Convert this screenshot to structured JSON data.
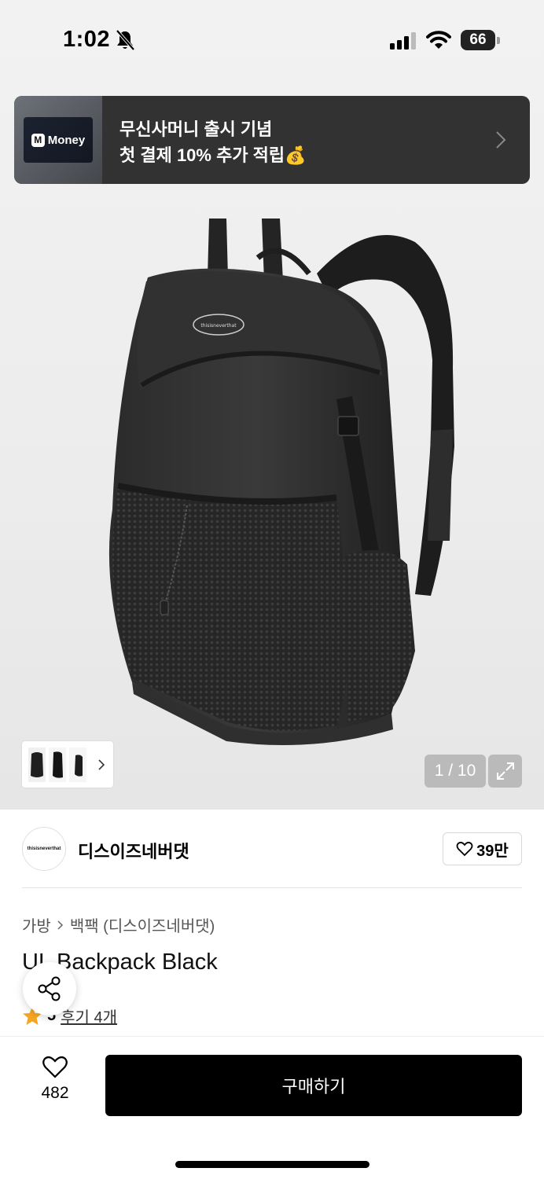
{
  "status_bar": {
    "time": "1:02",
    "battery": "66"
  },
  "banner": {
    "logo_text": "Money",
    "logo_mark": "M",
    "line1": "무신사머니 출시 기념",
    "line2": "첫 결제 10% 추가 적립💰"
  },
  "gallery": {
    "counter": "1 / 10"
  },
  "brand": {
    "name": "디스이즈네버댓",
    "logo_text": "thisisneverthat",
    "likes": "39만"
  },
  "breadcrumb": {
    "category": "가방",
    "subcategory": "백팩 (디스이즈네버댓)"
  },
  "product": {
    "title": "UL Backpack Black"
  },
  "rating": {
    "score": "5",
    "reviews_link": "후기 4개"
  },
  "bottom_bar": {
    "like_count": "482",
    "buy_label": "구매하기"
  },
  "icons": [
    "bell-slash-icon",
    "signal-icon",
    "wifi-icon",
    "battery-icon",
    "chevron-right-icon",
    "expand-icon",
    "heart-icon",
    "share-icon",
    "star-icon"
  ],
  "colors": {
    "banner_bg": "#323232",
    "buy_button": "#000000",
    "star": "#f5a623"
  }
}
